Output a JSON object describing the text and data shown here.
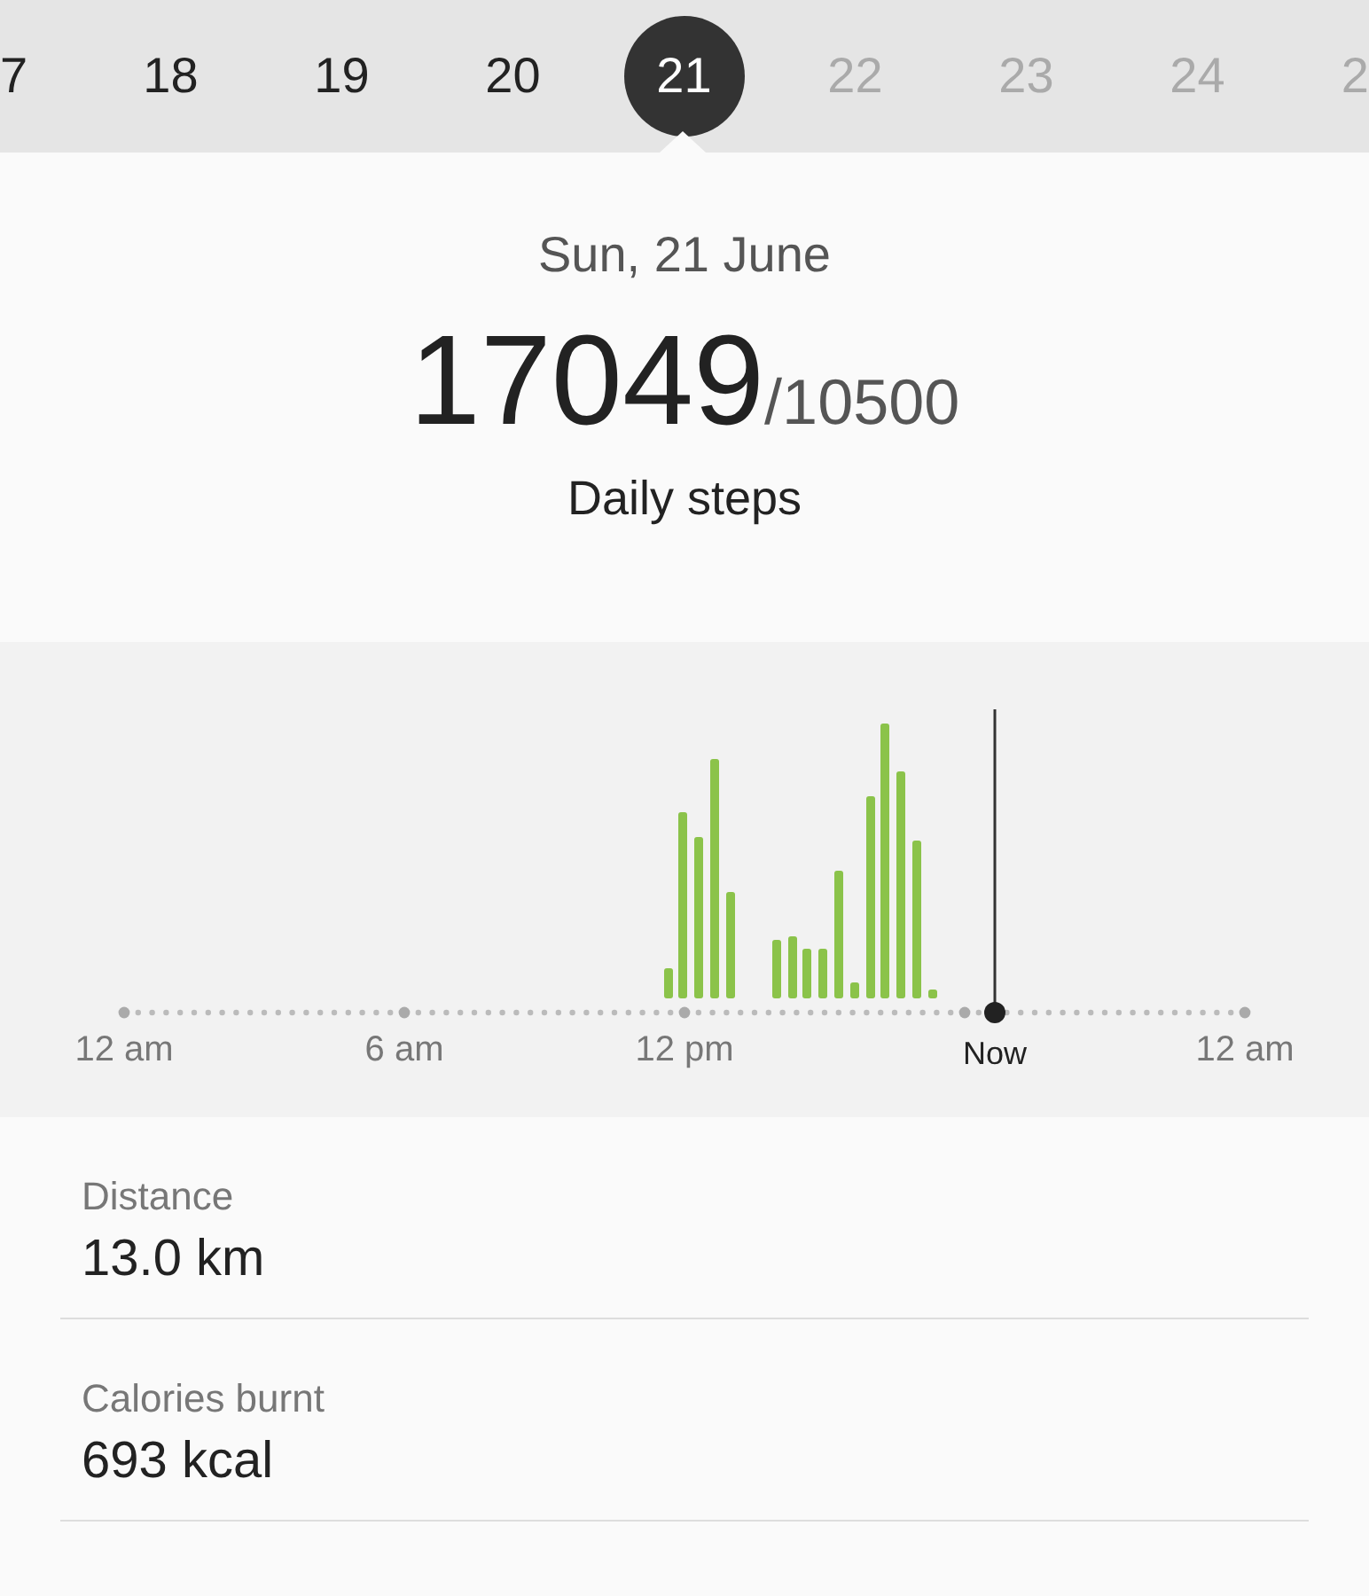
{
  "date_strip": [
    {
      "label": "7",
      "selected": false,
      "future": false
    },
    {
      "label": "18",
      "selected": false,
      "future": false
    },
    {
      "label": "19",
      "selected": false,
      "future": false
    },
    {
      "label": "20",
      "selected": false,
      "future": false
    },
    {
      "label": "21",
      "selected": true,
      "future": false
    },
    {
      "label": "22",
      "selected": false,
      "future": true
    },
    {
      "label": "23",
      "selected": false,
      "future": true
    },
    {
      "label": "24",
      "selected": false,
      "future": true
    },
    {
      "label": "2",
      "selected": false,
      "future": true
    }
  ],
  "summary": {
    "date": "Sun, 21 June",
    "steps": "17049",
    "goal": "/10500",
    "caption": "Daily steps"
  },
  "chart": {
    "axis_labels": [
      {
        "label": "12 am",
        "kind": "time"
      },
      {
        "label": "6 am",
        "kind": "time"
      },
      {
        "label": "12 pm",
        "kind": "time"
      },
      {
        "label": "Now",
        "kind": "now"
      },
      {
        "label": "12 am",
        "kind": "time"
      }
    ]
  },
  "stats": [
    {
      "label": "Distance",
      "value": "13.0 km"
    },
    {
      "label": "Calories burnt",
      "value": "693 kcal"
    }
  ]
}
